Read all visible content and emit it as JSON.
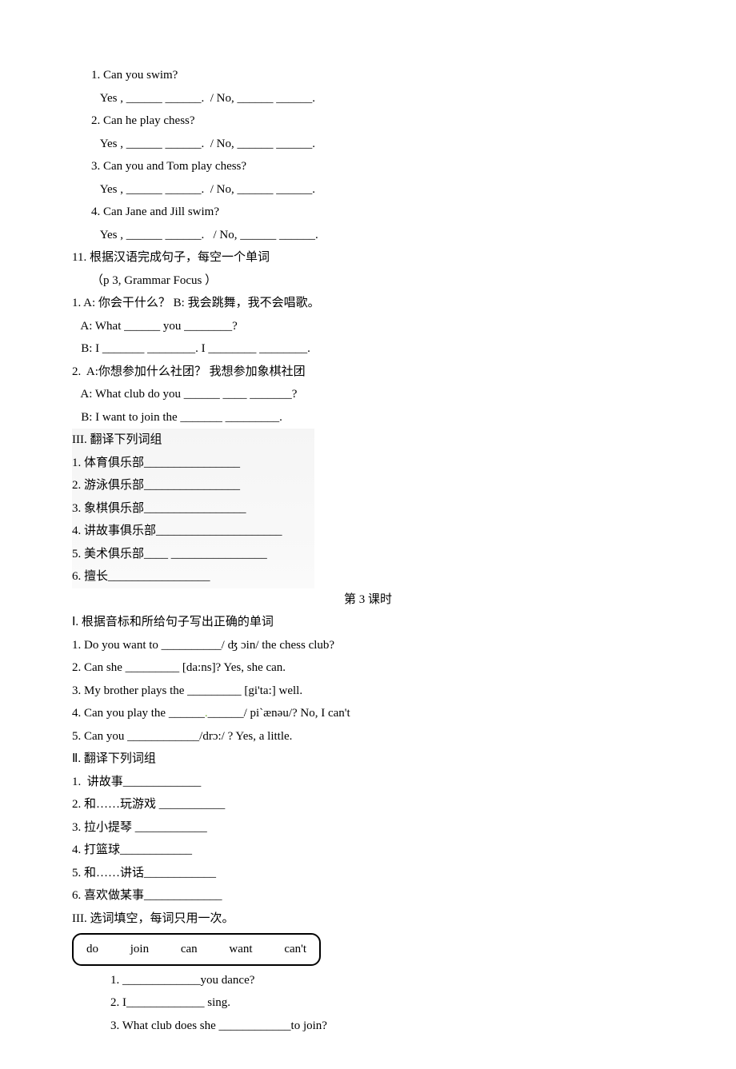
{
  "s1": {
    "q1": "1. Can you swim?",
    "q1a": "   Yes , ______ ______.  / No, ______ ______.",
    "q2": "2. Can he play chess?",
    "q2a": "   Yes , ______ ______.  / No, ______ ______.",
    "q3": "3. Can you and Tom play chess?",
    "q3a": "   Yes , ______ ______.  / No, ______ ______.",
    "q4": "4. Can Jane and Jill swim?",
    "q4a": "   Yes , ______ ______.   / No, ______ ______."
  },
  "s11title": "11. 根据汉语完成句子，每空一个单词",
  "s11sub": "（p 3, Grammar Focus ）",
  "s11a": {
    "l1": "1. A: 你会干什么？ B: 我会跳舞，我不会唱歌。",
    "l2": "   A: What ______ you ________?",
    "l3": "   B: I _______ ________. I ________ ________.",
    "l4": "2.  A:你想参加什么社团？ 我想参加象棋社团",
    "l5": "   A: What club do you ______ ____ _______?",
    "l6": "   B: I want to join the _______ _________."
  },
  "s3title": "III. 翻译下列词组",
  "s3": {
    "i1": "1. 体育俱乐部________________",
    "i2": "2. 游泳俱乐部________________",
    "i3": "3. 象棋俱乐部_________________",
    "i4": "4. 讲故事俱乐部_____________________",
    "i5": "5. 美术俱乐部____ ________________",
    "i6": "6. 擅长_________________"
  },
  "lesson3": "第 3 课时",
  "p2s1title": "Ⅰ. 根据音标和所给句子写出正确的单词",
  "p2s1": {
    "q1a": "1. Do you want to __________/ ʤ",
    "q1b": "in/ the chess club?",
    "q2": "2. Can she _________ [da:ns]? Yes, she can.",
    "q3": "3. My brother plays the _________ [gi'ta:] well.",
    "q4a": "4. Can you play the ______",
    "q4b": "______/ pi`ænəu/? No, I can't",
    "q5a": "5. Can you ____________/dr",
    "q5b": ":/ ? Yes, a little."
  },
  "p2s2title": "Ⅱ. 翻译下列词组",
  "p2s2": {
    "i1": "1.  讲故事_____________",
    "i2": "2. 和……玩游戏 ___________",
    "i3": "3. 拉小提琴 ____________",
    "i4": "4. 打篮球____________",
    "i5": "5. 和……讲话____________",
    "i6": "6. 喜欢做某事_____________"
  },
  "p2s3title": "III. 选词填空，每词只用一次。",
  "wordbox": {
    "w1": "do",
    "w2": "join",
    "w3": "can",
    "w4": "want",
    "w5": "can't"
  },
  "p2s3": {
    "q1": "1. _____________you dance?",
    "q2": "2. I_____________ sing.",
    "q3": "3. What club does she ____________to join?"
  }
}
